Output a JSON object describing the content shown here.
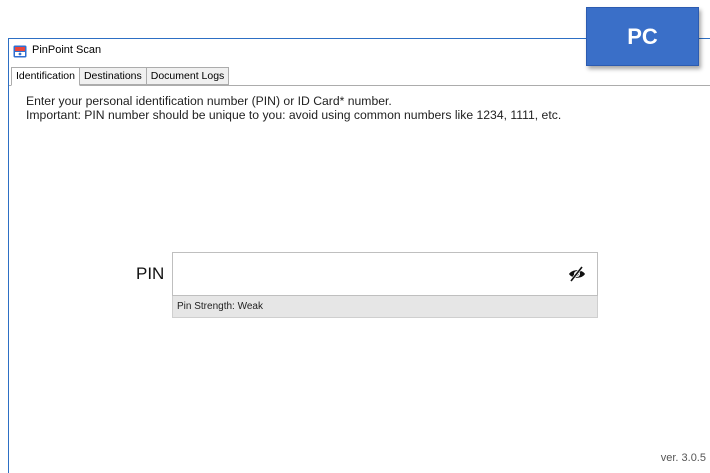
{
  "window": {
    "title": "PinPoint Scan",
    "icon": "pinpoint-app-icon"
  },
  "tabs": [
    {
      "label": "Identification",
      "active": true
    },
    {
      "label": "Destinations",
      "active": false
    },
    {
      "label": "Document Logs",
      "active": false
    }
  ],
  "instructions": {
    "line1": "Enter your personal identification number (PIN) or ID Card* number.",
    "line2": "Important: PIN number should be unique to you: avoid using common numbers like 1234, 1111, etc."
  },
  "pin": {
    "label": "PIN",
    "value": "",
    "toggle_icon": "eye-hidden-icon",
    "strength_text": "Pin Strength: Weak"
  },
  "version": "ver. 3.0.5",
  "badge": {
    "label": "PC",
    "color": "#3a6fc8"
  }
}
